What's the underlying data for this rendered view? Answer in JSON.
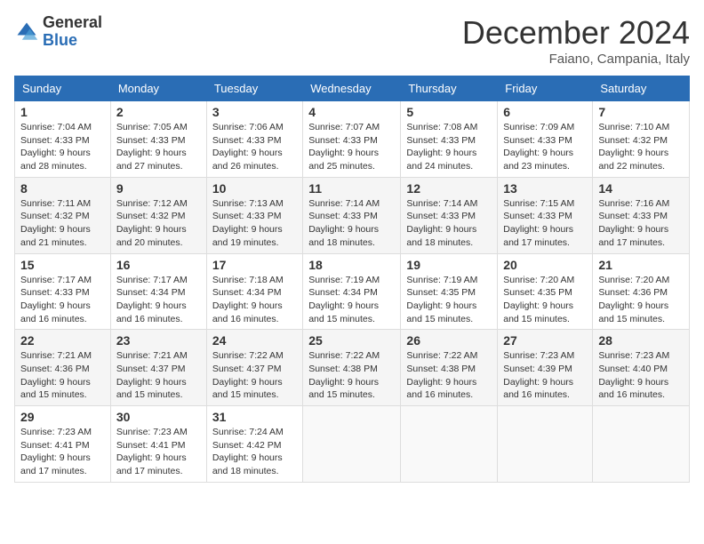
{
  "header": {
    "logo_general": "General",
    "logo_blue": "Blue",
    "month_title": "December 2024",
    "location": "Faiano, Campania, Italy"
  },
  "weekdays": [
    "Sunday",
    "Monday",
    "Tuesday",
    "Wednesday",
    "Thursday",
    "Friday",
    "Saturday"
  ],
  "weeks": [
    [
      {
        "day": "1",
        "sunrise": "7:04 AM",
        "sunset": "4:33 PM",
        "daylight": "9 hours and 28 minutes."
      },
      {
        "day": "2",
        "sunrise": "7:05 AM",
        "sunset": "4:33 PM",
        "daylight": "9 hours and 27 minutes."
      },
      {
        "day": "3",
        "sunrise": "7:06 AM",
        "sunset": "4:33 PM",
        "daylight": "9 hours and 26 minutes."
      },
      {
        "day": "4",
        "sunrise": "7:07 AM",
        "sunset": "4:33 PM",
        "daylight": "9 hours and 25 minutes."
      },
      {
        "day": "5",
        "sunrise": "7:08 AM",
        "sunset": "4:33 PM",
        "daylight": "9 hours and 24 minutes."
      },
      {
        "day": "6",
        "sunrise": "7:09 AM",
        "sunset": "4:33 PM",
        "daylight": "9 hours and 23 minutes."
      },
      {
        "day": "7",
        "sunrise": "7:10 AM",
        "sunset": "4:32 PM",
        "daylight": "9 hours and 22 minutes."
      }
    ],
    [
      {
        "day": "8",
        "sunrise": "7:11 AM",
        "sunset": "4:32 PM",
        "daylight": "9 hours and 21 minutes."
      },
      {
        "day": "9",
        "sunrise": "7:12 AM",
        "sunset": "4:32 PM",
        "daylight": "9 hours and 20 minutes."
      },
      {
        "day": "10",
        "sunrise": "7:13 AM",
        "sunset": "4:33 PM",
        "daylight": "9 hours and 19 minutes."
      },
      {
        "day": "11",
        "sunrise": "7:14 AM",
        "sunset": "4:33 PM",
        "daylight": "9 hours and 18 minutes."
      },
      {
        "day": "12",
        "sunrise": "7:14 AM",
        "sunset": "4:33 PM",
        "daylight": "9 hours and 18 minutes."
      },
      {
        "day": "13",
        "sunrise": "7:15 AM",
        "sunset": "4:33 PM",
        "daylight": "9 hours and 17 minutes."
      },
      {
        "day": "14",
        "sunrise": "7:16 AM",
        "sunset": "4:33 PM",
        "daylight": "9 hours and 17 minutes."
      }
    ],
    [
      {
        "day": "15",
        "sunrise": "7:17 AM",
        "sunset": "4:33 PM",
        "daylight": "9 hours and 16 minutes."
      },
      {
        "day": "16",
        "sunrise": "7:17 AM",
        "sunset": "4:34 PM",
        "daylight": "9 hours and 16 minutes."
      },
      {
        "day": "17",
        "sunrise": "7:18 AM",
        "sunset": "4:34 PM",
        "daylight": "9 hours and 16 minutes."
      },
      {
        "day": "18",
        "sunrise": "7:19 AM",
        "sunset": "4:34 PM",
        "daylight": "9 hours and 15 minutes."
      },
      {
        "day": "19",
        "sunrise": "7:19 AM",
        "sunset": "4:35 PM",
        "daylight": "9 hours and 15 minutes."
      },
      {
        "day": "20",
        "sunrise": "7:20 AM",
        "sunset": "4:35 PM",
        "daylight": "9 hours and 15 minutes."
      },
      {
        "day": "21",
        "sunrise": "7:20 AM",
        "sunset": "4:36 PM",
        "daylight": "9 hours and 15 minutes."
      }
    ],
    [
      {
        "day": "22",
        "sunrise": "7:21 AM",
        "sunset": "4:36 PM",
        "daylight": "9 hours and 15 minutes."
      },
      {
        "day": "23",
        "sunrise": "7:21 AM",
        "sunset": "4:37 PM",
        "daylight": "9 hours and 15 minutes."
      },
      {
        "day": "24",
        "sunrise": "7:22 AM",
        "sunset": "4:37 PM",
        "daylight": "9 hours and 15 minutes."
      },
      {
        "day": "25",
        "sunrise": "7:22 AM",
        "sunset": "4:38 PM",
        "daylight": "9 hours and 15 minutes."
      },
      {
        "day": "26",
        "sunrise": "7:22 AM",
        "sunset": "4:38 PM",
        "daylight": "9 hours and 16 minutes."
      },
      {
        "day": "27",
        "sunrise": "7:23 AM",
        "sunset": "4:39 PM",
        "daylight": "9 hours and 16 minutes."
      },
      {
        "day": "28",
        "sunrise": "7:23 AM",
        "sunset": "4:40 PM",
        "daylight": "9 hours and 16 minutes."
      }
    ],
    [
      {
        "day": "29",
        "sunrise": "7:23 AM",
        "sunset": "4:41 PM",
        "daylight": "9 hours and 17 minutes."
      },
      {
        "day": "30",
        "sunrise": "7:23 AM",
        "sunset": "4:41 PM",
        "daylight": "9 hours and 17 minutes."
      },
      {
        "day": "31",
        "sunrise": "7:24 AM",
        "sunset": "4:42 PM",
        "daylight": "9 hours and 18 minutes."
      },
      null,
      null,
      null,
      null
    ]
  ],
  "labels": {
    "sunrise": "Sunrise:",
    "sunset": "Sunset:",
    "daylight": "Daylight:"
  }
}
